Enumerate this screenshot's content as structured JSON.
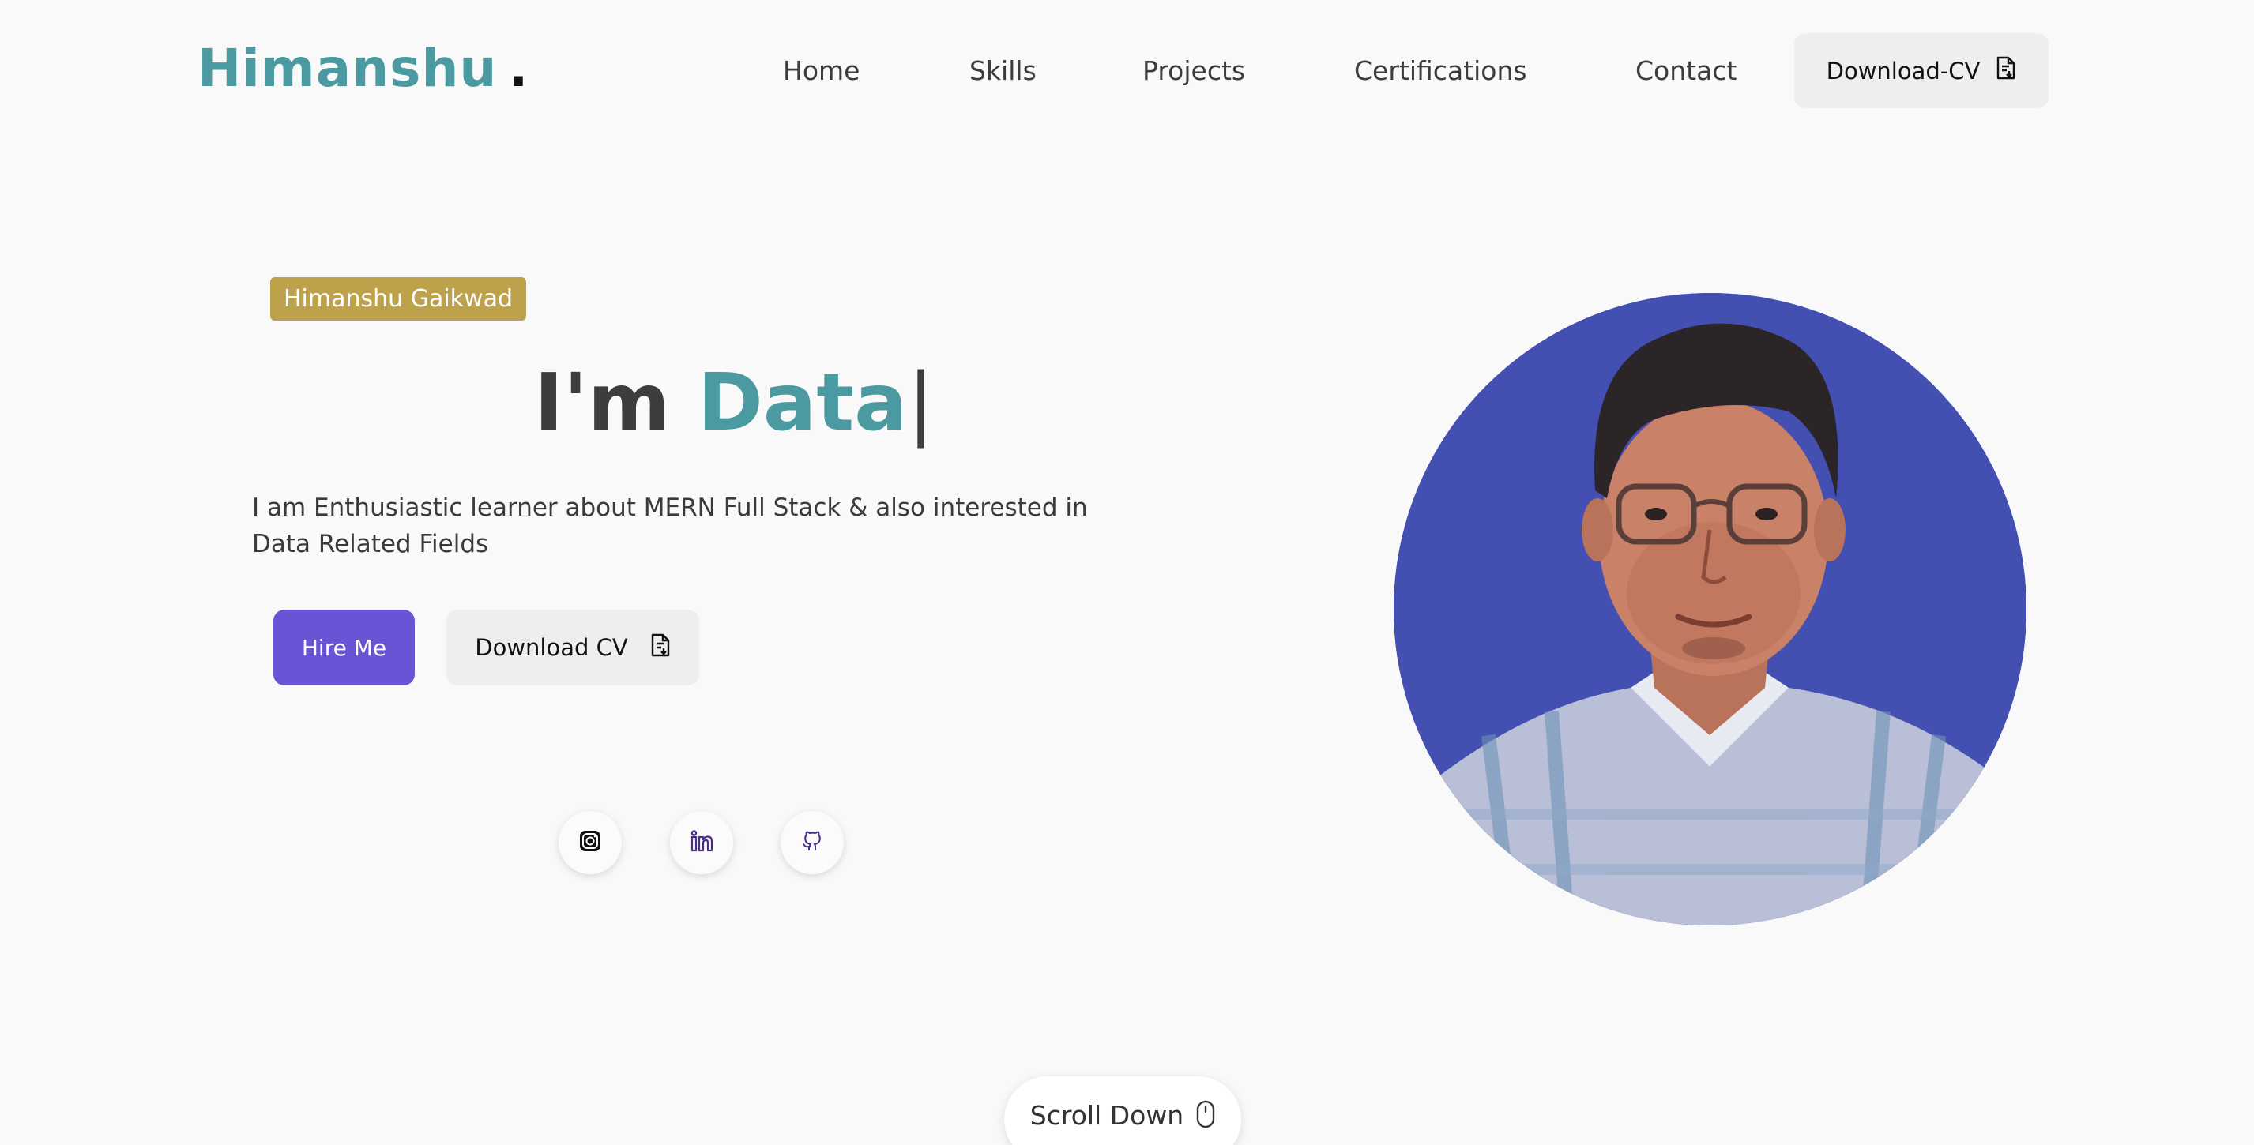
{
  "header": {
    "logo": "Himanshu",
    "logo_dot": ".",
    "nav": {
      "home": "Home",
      "skills": "Skills",
      "projects": "Projects",
      "certifications": "Certifications",
      "contact": "Contact"
    },
    "download_cv": "Download-CV"
  },
  "hero": {
    "name_tag": "Himanshu Gaikwad",
    "title_prefix": "I'm",
    "title_typed": "Data",
    "title_cursor": "|",
    "description": "I am Enthusiastic learner about MERN Full Stack & also interested in Data Related Fields",
    "hire_button": "Hire Me",
    "download_button": "Download CV",
    "socials": [
      "instagram-icon",
      "linkedin-icon",
      "github-icon"
    ]
  },
  "scroll": {
    "label": "Scroll Down"
  },
  "colors": {
    "accent": "#4b9aa2",
    "tag": "#bda24b",
    "primary_button": "#6b53d6",
    "portrait_bg": "#444fb2"
  }
}
